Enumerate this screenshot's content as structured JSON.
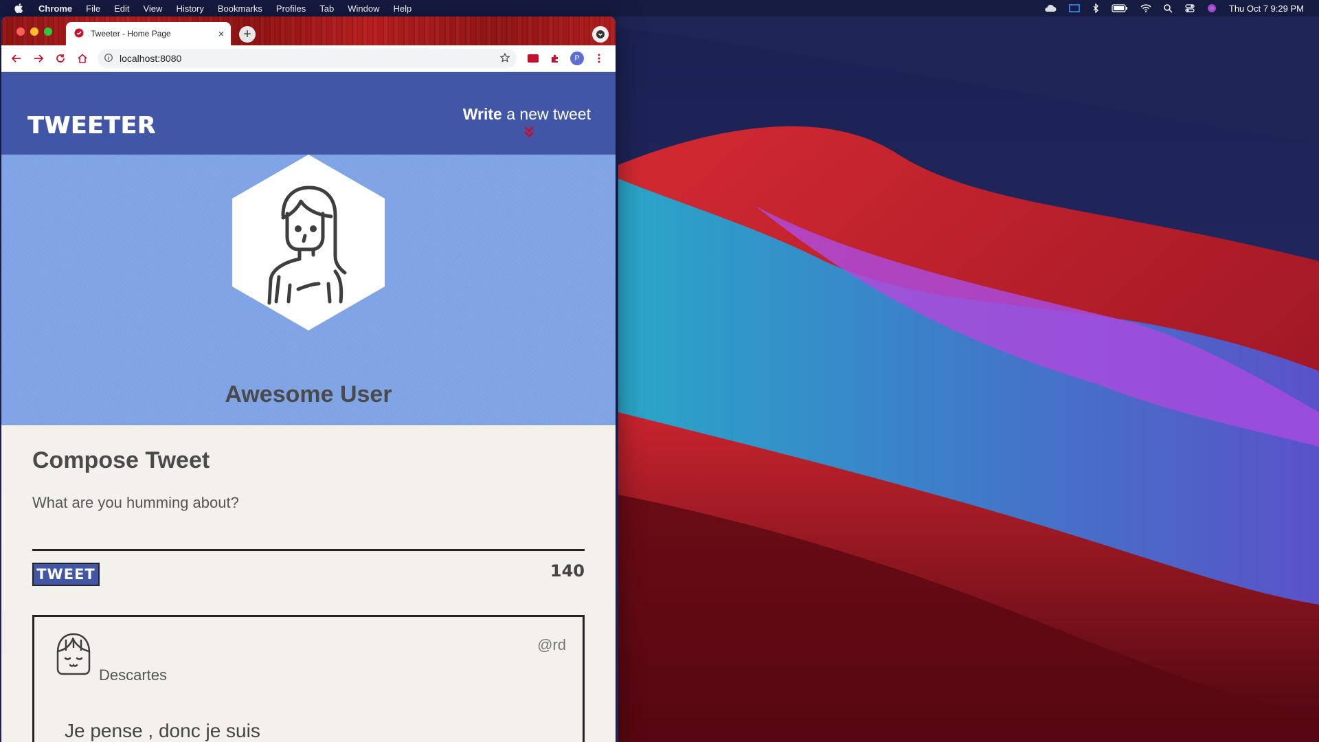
{
  "menubar": {
    "app_name": "Chrome",
    "menus": [
      "File",
      "Edit",
      "View",
      "History",
      "Bookmarks",
      "Profiles",
      "Tab",
      "Window",
      "Help"
    ],
    "datetime": "Thu Oct 7  9:29 PM"
  },
  "browser": {
    "tab_title": "Tweeter - Home Page",
    "tab_close": "×",
    "new_tab": "+",
    "url": "localhost:8080",
    "profile_initial": "P"
  },
  "site": {
    "logo": "TWEETER",
    "write_bold": "Write",
    "write_rest": " a new tweet",
    "accent": "#c8102e",
    "nav_color": "#4156a6",
    "hero_color": "#7fa4e6"
  },
  "profile": {
    "name": "Awesome User"
  },
  "compose": {
    "title": "Compose Tweet",
    "placeholder": "What are you humming about?",
    "button": "TWEET",
    "counter": "140"
  },
  "tweets": [
    {
      "name": "Descartes",
      "handle": "@rd",
      "text": "Je pense , donc je suis"
    }
  ]
}
